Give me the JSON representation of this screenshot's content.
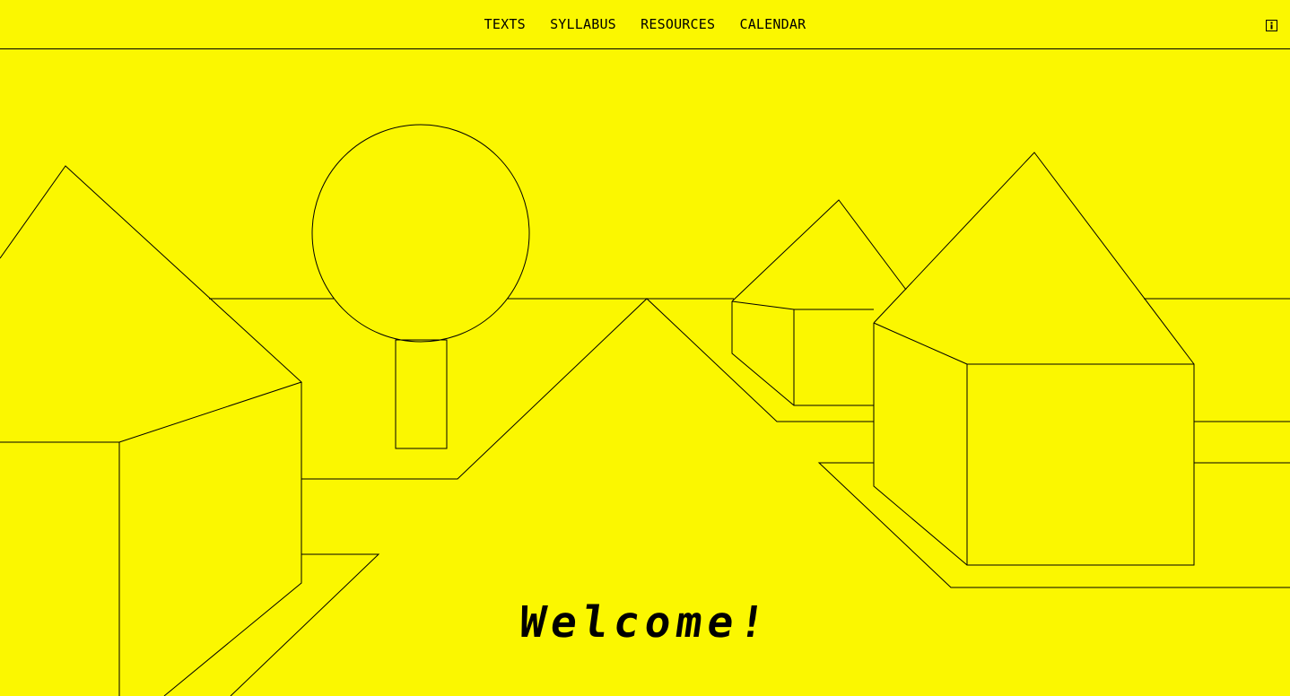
{
  "nav": {
    "items": [
      {
        "label": "TEXTS"
      },
      {
        "label": "SYLLABUS"
      },
      {
        "label": "RESOURCES"
      },
      {
        "label": "CALENDAR"
      }
    ]
  },
  "info_button": {
    "icon": "info-icon"
  },
  "hero": {
    "welcome_text": "Welcome!"
  },
  "colors": {
    "background": "#FBF700",
    "line": "#000000"
  }
}
